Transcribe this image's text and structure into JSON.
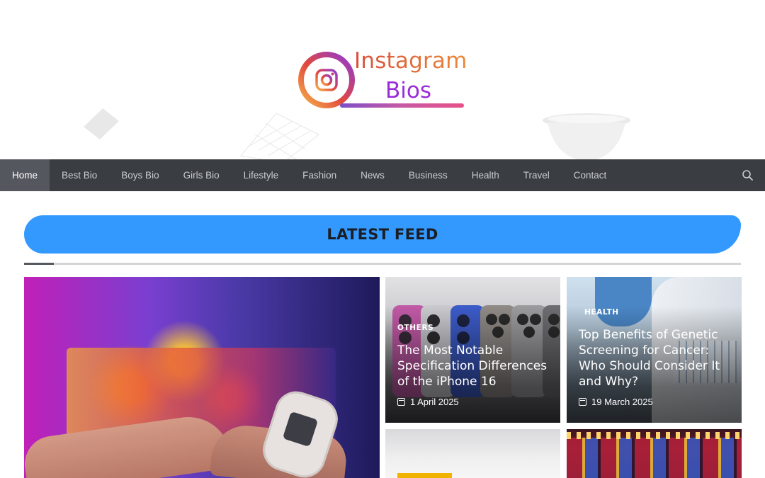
{
  "header": {
    "logo_word_1": "Instagram",
    "logo_word_2": "Bios"
  },
  "nav": {
    "items": [
      {
        "label": "Home",
        "active": true
      },
      {
        "label": "Best Bio"
      },
      {
        "label": "Boys Bio"
      },
      {
        "label": "Girls Bio"
      },
      {
        "label": "Lifestyle"
      },
      {
        "label": "Fashion"
      },
      {
        "label": "News"
      },
      {
        "label": "Business"
      },
      {
        "label": "Health"
      },
      {
        "label": "Travel"
      },
      {
        "label": "Contact"
      }
    ],
    "search_icon": "search-icon"
  },
  "feed": {
    "title": "LATEST FEED",
    "accent_color": "#3399ff"
  },
  "cards": [
    {
      "category": "OTHERS",
      "title": "The Most Notable Specification Differences of the iPhone 16",
      "date": "1 April 2025"
    },
    {
      "category": "HEALTH",
      "title": "Top Benefits of Genetic Screening for Cancer: Who Should Consider It and Why?",
      "date": "19 March 2025"
    }
  ],
  "colors": {
    "nav_bg": "#3a3d42",
    "nav_active_bg": "#54575d",
    "banner": "#3399ff",
    "tag_yellow": "#f0b400"
  }
}
